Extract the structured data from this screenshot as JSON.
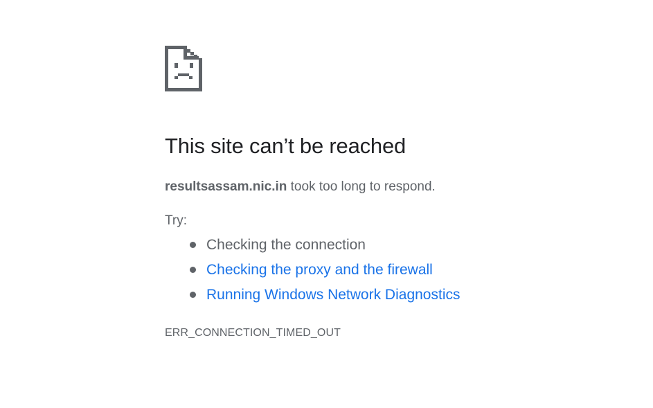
{
  "page": {
    "heading": "This site can’t be reached",
    "host": "resultsassam.nic.in",
    "summary_suffix": " took too long to respond.",
    "try_label": "Try:",
    "suggestions": [
      {
        "label": "Checking the connection",
        "link": false
      },
      {
        "label": "Checking the proxy and the firewall",
        "link": true
      },
      {
        "label": "Running Windows Network Diagnostics",
        "link": true
      }
    ],
    "error_code": "ERR_CONNECTION_TIMED_OUT"
  },
  "colors": {
    "heading": "#202124",
    "text": "#5f6368",
    "link": "#1a73e8",
    "icon": "#5f6368",
    "background": "#ffffff"
  },
  "icons": {
    "error_icon": "sad-page-icon"
  }
}
